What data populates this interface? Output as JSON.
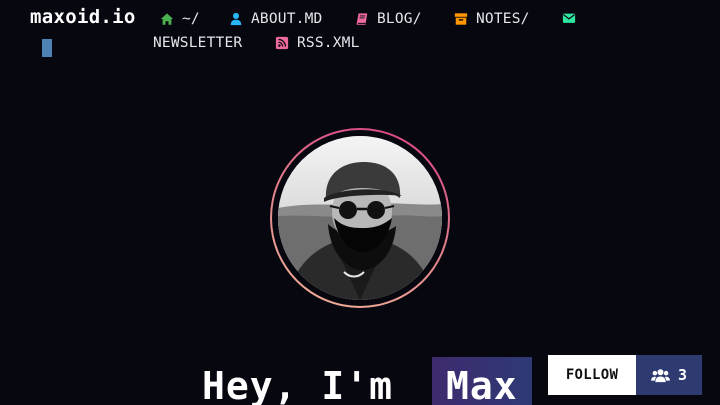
{
  "site": {
    "title": "maxoid.io"
  },
  "nav": {
    "items": [
      {
        "label": "~/",
        "icon": "home-icon",
        "color": "#4caf50"
      },
      {
        "label": "ABOUT.MD",
        "icon": "user-icon",
        "color": "#29b6f6"
      },
      {
        "label": "BLOG/",
        "icon": "book-icon",
        "color": "#ec6a9c"
      },
      {
        "label": "NOTES/",
        "icon": "archive-icon",
        "color": "#ff9800"
      },
      {
        "label": "NEWSLETTER",
        "icon": "envelope-icon",
        "color": "#2ee6a0"
      },
      {
        "label": "RSS.XML",
        "icon": "rss-icon",
        "color": "#ec6a9c"
      }
    ]
  },
  "hero": {
    "greeting": "Hey, I'm",
    "name": "Max"
  },
  "follow": {
    "label": "FOLLOW",
    "count": "3",
    "icon": "users-icon"
  },
  "colors": {
    "background": "#06070f",
    "accent_ring": [
      "#d63d86",
      "#f2b59a"
    ],
    "name_highlight": "#3a3170",
    "follow_count_bg": "#2e3a70"
  }
}
